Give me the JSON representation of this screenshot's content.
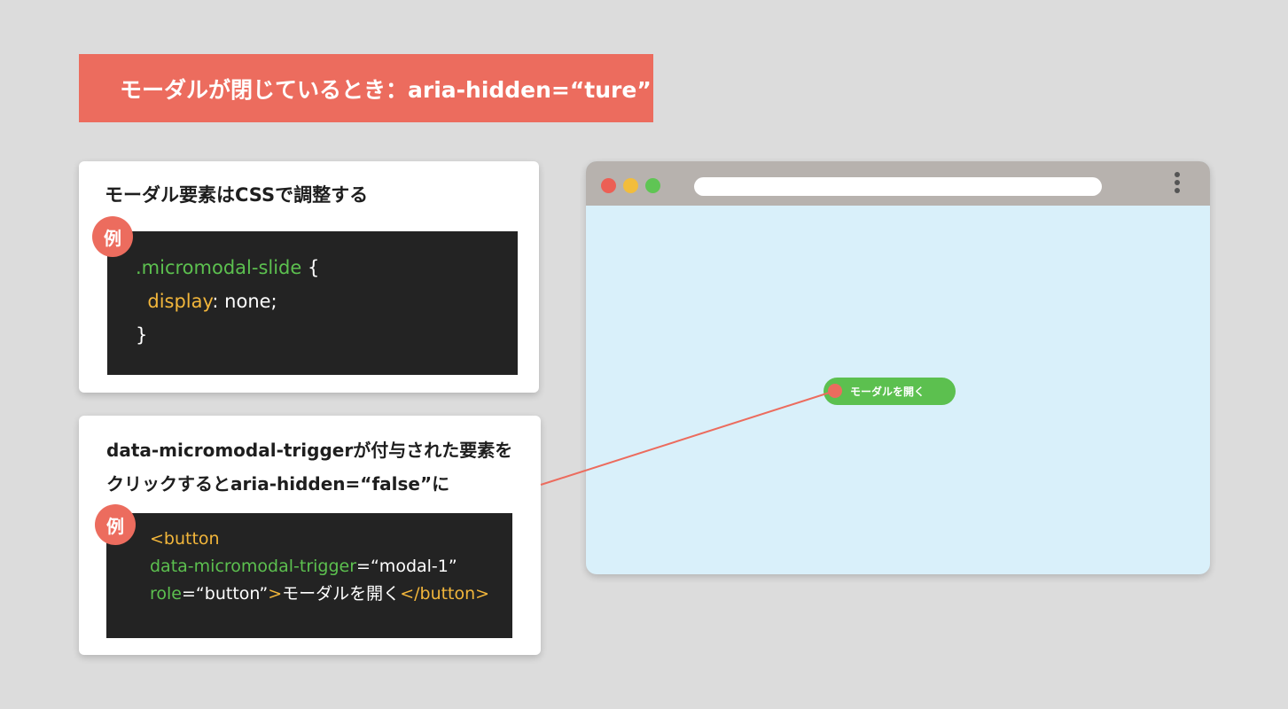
{
  "title": "モーダルが閉じているとき：aria-hidden=“ture”",
  "card1": {
    "heading": "モーダル要素はCSSで調整する",
    "badge": "例",
    "code": {
      "selector": ".micromodal-slide",
      "brace_open": " {",
      "property": "display",
      "value": ": none;",
      "brace_close": "}"
    }
  },
  "card2": {
    "heading_line1": "data-micromodal-triggerが付与された要素を",
    "heading_line2": "クリックするとaria-hidden=“false”に",
    "badge": "例",
    "code": {
      "tag_open": "<button",
      "attr1_name": "data-micromodal-trigger",
      "attr1_value": "=“modal-1”",
      "attr2_name": "role",
      "attr2_value": "=“button”",
      "gt": ">",
      "inner_text": "モーダルを開く",
      "tag_close": "</button>"
    }
  },
  "browser": {
    "button_label": "モーダルを開く"
  },
  "colors": {
    "accent": "#ec6c5e",
    "green": "#5cc04f",
    "yellow": "#f2b63b",
    "code_bg": "#232323",
    "browser_bg": "#d9f0fa"
  }
}
